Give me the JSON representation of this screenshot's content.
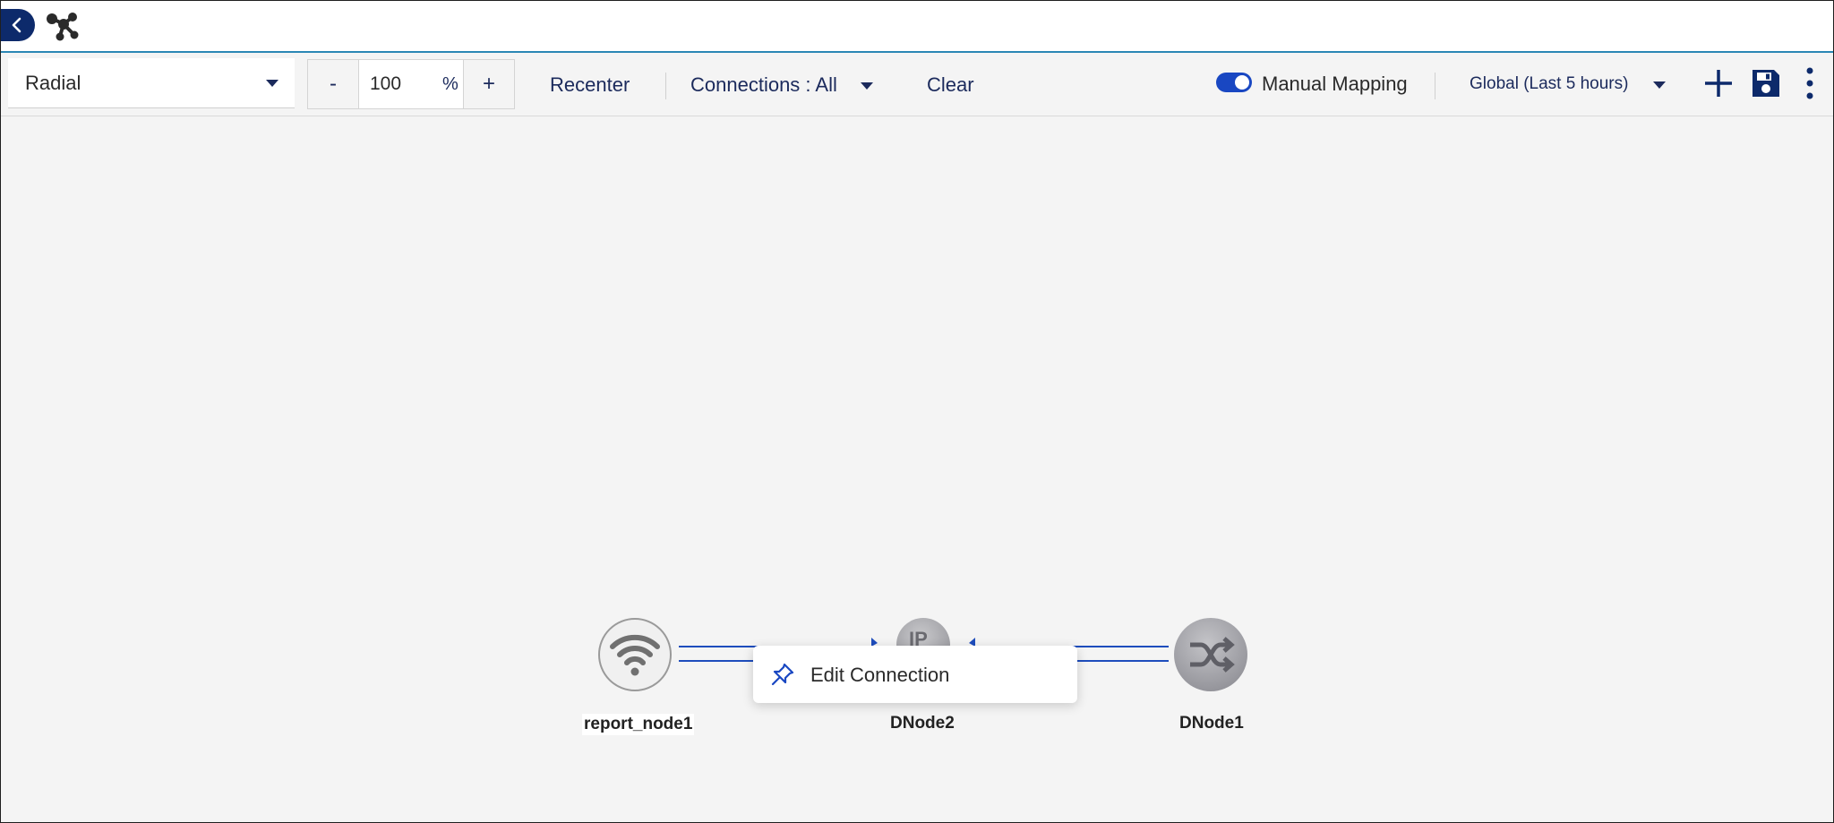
{
  "header": {
    "back_icon": "chevron-left-icon",
    "logo_icon": "topology-icon"
  },
  "toolbar": {
    "layout_value": "Radial",
    "zoom": {
      "minus_label": "-",
      "value": "100",
      "percent_label": "%",
      "plus_label": "+"
    },
    "recenter_label": "Recenter",
    "connections_label": "Connections : All",
    "clear_label": "Clear",
    "manual_mapping": {
      "label": "Manual Mapping",
      "enabled": true
    },
    "time_range_label": "Global (Last 5 hours)",
    "add_icon": "plus-icon",
    "save_icon": "save-icon",
    "more_icon": "kebab-icon"
  },
  "map": {
    "nodes": [
      {
        "label": "report_node1",
        "icon": "wifi-icon"
      },
      {
        "label": "DNode2",
        "icon": "ip-icon",
        "icon_text": "IP"
      },
      {
        "label": "DNode1",
        "icon": "shuffle-icon"
      }
    ]
  },
  "context_menu": {
    "items": [
      {
        "label": "Edit Connection",
        "icon": "pin-icon"
      }
    ]
  },
  "colors": {
    "accent": "#1947c2",
    "navy": "#0d2a6b",
    "edge": "#1e4dbd",
    "header_border": "#2b87b5",
    "canvas_bg": "#f4f4f4"
  }
}
